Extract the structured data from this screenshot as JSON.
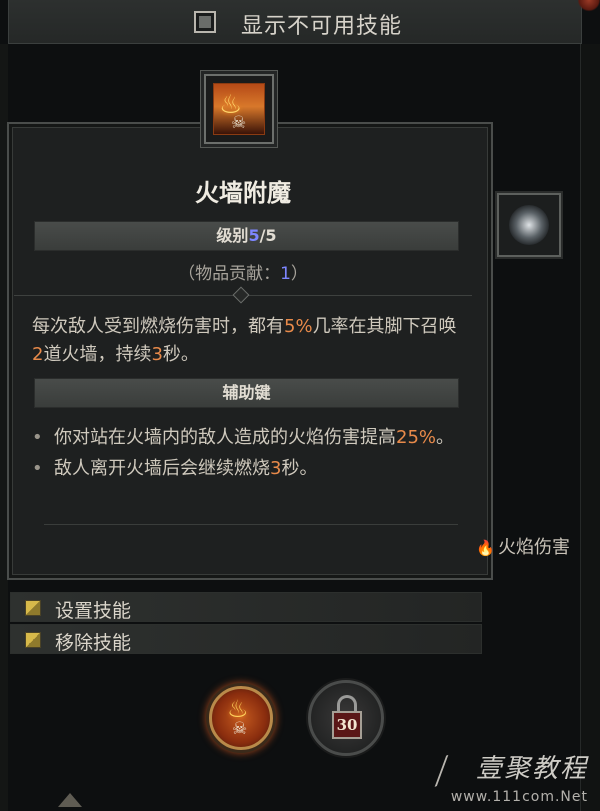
{
  "top_bar": {
    "checkbox_label": "显示不可用技能",
    "checked": false
  },
  "skill": {
    "title": "火墙附魔",
    "rank_label": "级别",
    "rank_current": "5",
    "rank_sep": "/",
    "rank_max": "5",
    "item_contrib_prefix": "（物品贡献：",
    "item_contrib_value": "1",
    "item_contrib_suffix": "）",
    "description": {
      "p1": "每次敌人受到燃烧伤害时，都有",
      "chance": "5%",
      "p2": "几率在其脚下召唤",
      "count": "2",
      "p3": "道火墙，持续",
      "duration": "3",
      "p4": "秒。"
    },
    "modifier_header": "辅助键",
    "modifiers": [
      {
        "bullet": "•",
        "p1": "你对站在火墙内的敌人造成的火焰伤害提高",
        "value": "25%",
        "p2": "。"
      },
      {
        "bullet": "•",
        "p1": "敌人离开火墙后会继续燃烧",
        "value": "3",
        "p2": "秒。"
      }
    ],
    "damage_type": "火焰伤害",
    "damage_icon": "flame-icon"
  },
  "actions": [
    {
      "label": "设置技能",
      "icon": "keybind-icon"
    },
    {
      "label": "移除技能",
      "icon": "keybind-icon"
    }
  ],
  "locked_slot": {
    "level": "30",
    "icon": "lock-icon"
  },
  "watermark": {
    "brand": "壹聚教程",
    "site": "www.111com.Net"
  },
  "colors": {
    "highlight": "#e88a4a",
    "rank_number": "#7d86ff",
    "panel_bg": "#1e2020"
  }
}
